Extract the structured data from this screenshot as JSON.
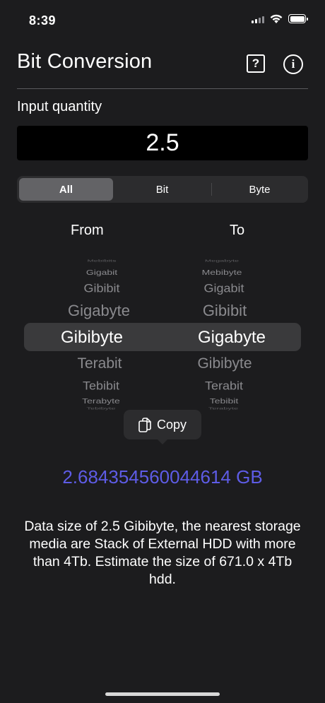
{
  "status_bar": {
    "time": "8:39"
  },
  "header": {
    "title": "Bit Conversion",
    "help_label": "?",
    "info_label": "i"
  },
  "input": {
    "label": "Input quantity",
    "value": "2.5"
  },
  "segments": [
    {
      "label": "All",
      "selected": true
    },
    {
      "label": "Bit",
      "selected": false
    },
    {
      "label": "Byte",
      "selected": false
    }
  ],
  "columns": {
    "from": "From",
    "to": "To"
  },
  "picker": {
    "from": [
      "Mebibits",
      "Gigabit",
      "Gibibit",
      "Gigabyte",
      "Gibibyte",
      "Terabit",
      "Tebibit",
      "Terabyte",
      "Tebibyte"
    ],
    "to": [
      "Megabyte",
      "Mebibyte",
      "Gigabit",
      "Gibibit",
      "Gigabyte",
      "Gibibyte",
      "Terabit",
      "Tebibit",
      "Terabyte"
    ],
    "selected_from": "Gibibyte",
    "selected_to": "Gigabyte"
  },
  "tooltip": {
    "label": "Copy"
  },
  "result": "2.684354560044614 GB",
  "description": "Data size of 2.5 Gibibyte, the nearest storage media are Stack of External HDD with more than 4Tb. Estimate the size of 671.0 x 4Tb hdd.",
  "colors": {
    "background": "#1c1c1e",
    "accent": "#5e5ce6",
    "input_bg": "#000000"
  }
}
